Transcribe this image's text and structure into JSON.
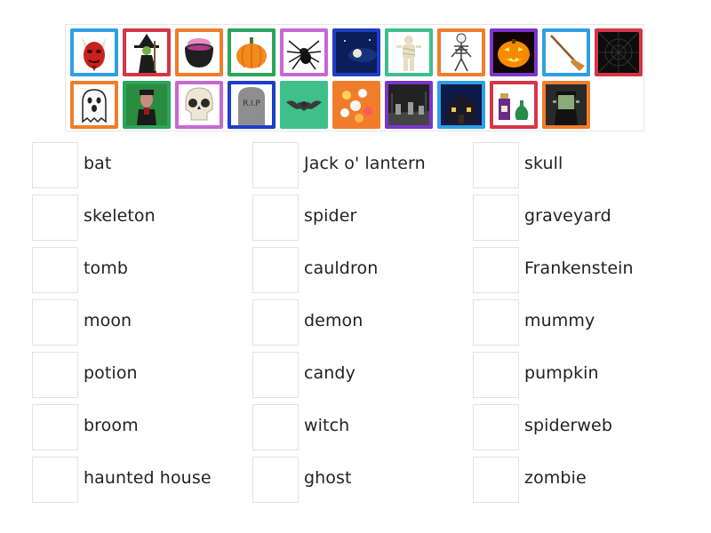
{
  "tiles": [
    {
      "icon": "devil-mask-icon",
      "border": "#2f9fe3"
    },
    {
      "icon": "witch-icon",
      "border": "#d63548"
    },
    {
      "icon": "cauldron-icon",
      "border": "#f07d2b"
    },
    {
      "icon": "pumpkin-icon",
      "border": "#2aa55a"
    },
    {
      "icon": "spider-icon",
      "border": "#c768d4"
    },
    {
      "icon": "moon-night-icon",
      "border": "#1f3ec6"
    },
    {
      "icon": "mummy-icon",
      "border": "#3fbf8a"
    },
    {
      "icon": "skeleton-icon",
      "border": "#f07d2b"
    },
    {
      "icon": "jack-o-lantern-icon",
      "border": "#7a35c9"
    },
    {
      "icon": "broom-icon",
      "border": "#2f9fe3"
    },
    {
      "icon": "spiderweb-icon",
      "border": "#d63548"
    },
    {
      "icon": "ghost-icon",
      "border": "#f07d2b"
    },
    {
      "icon": "zombie-icon",
      "border": "#2aa55a"
    },
    {
      "icon": "skull-icon",
      "border": "#c768d4"
    },
    {
      "icon": "tombstone-icon",
      "border": "#1f3ec6"
    },
    {
      "icon": "bat-icon",
      "border": "#3fbf8a"
    },
    {
      "icon": "candy-icon",
      "border": "#f07d2b"
    },
    {
      "icon": "graveyard-icon",
      "border": "#7a35c9"
    },
    {
      "icon": "haunted-house-icon",
      "border": "#2f9fe3"
    },
    {
      "icon": "potion-icon",
      "border": "#d63548"
    },
    {
      "icon": "frankenstein-icon",
      "border": "#f07d2b"
    }
  ],
  "words": {
    "col1": [
      "bat",
      "skeleton",
      "tomb",
      "moon",
      "potion",
      "broom",
      "haunted house"
    ],
    "col2": [
      "Jack o' lantern",
      "spider",
      "cauldron",
      "demon",
      "candy",
      "witch",
      "ghost"
    ],
    "col3": [
      "skull",
      "graveyard",
      "Frankenstein",
      "mummy",
      "pumpkin",
      "spiderweb",
      "zombie"
    ]
  }
}
